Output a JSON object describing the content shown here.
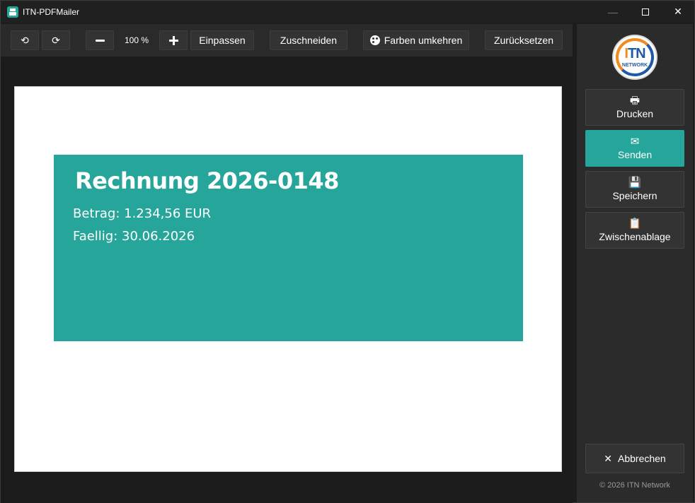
{
  "window": {
    "title": "ITN-PDFMailer",
    "controls": {
      "minimize": "—",
      "close": "✕"
    }
  },
  "toolbar": {
    "rotate_left_icon": "⟲",
    "rotate_right_icon": "⟳",
    "zoom_level": "100 %",
    "fit_label": "Einpassen",
    "crop_label": "Zuschneiden",
    "invert_label": "Farben umkehren",
    "reset_label": "Zurücksetzen"
  },
  "document": {
    "title": "Rechnung 2026-0148",
    "amount": "Betrag: 1.234,56 EUR",
    "due": "Faellig: 30.06.2026",
    "accent_color": "#26a69a"
  },
  "sidebar": {
    "logo": {
      "brand": "TN",
      "brand_initial": "I",
      "sub": "NETWORK"
    },
    "actions": [
      {
        "label": "Drucken",
        "icon": "printer-icon",
        "glyph": "🖶"
      },
      {
        "label": "Senden",
        "icon": "envelope-icon",
        "glyph": "✉"
      },
      {
        "label": "Speichern",
        "icon": "save-icon",
        "glyph": "💾"
      },
      {
        "label": "Zwischenablage",
        "icon": "clipboard-icon",
        "glyph": "📋"
      }
    ],
    "cancel_label": "Abbrechen",
    "cancel_glyph": "✕",
    "copyright": "© 2026 ITN Network"
  },
  "colors": {
    "accent": "#26a69a",
    "background": "#1c1c1c",
    "panel": "#2b2b2b"
  }
}
